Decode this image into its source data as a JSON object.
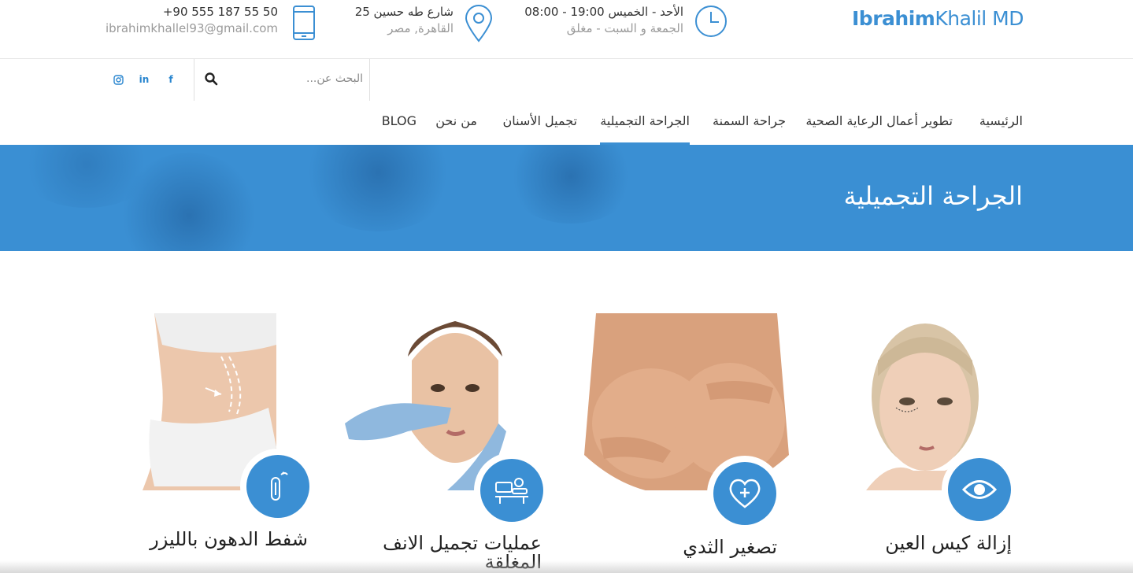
{
  "header": {
    "logo_bold": "Ibrahim",
    "logo_rest": "Khalil MD",
    "hours_line1": "الأحد - الخميس 19:00 - 08:00",
    "hours_line2": "الجمعة و السبت - مغلق",
    "address_line1": "شارع طه حسين 25",
    "address_line2": "القاهرة, مصر",
    "phone_line1": "+90 555 187 55 50",
    "phone_line2": "ibrahimkhallel93@gmail.com"
  },
  "search": {
    "placeholder": "البحث عن..."
  },
  "social": [
    "instagram-icon",
    "linkedin-icon",
    "facebook-icon"
  ],
  "social_labels": {
    "linkedin": "in",
    "facebook": "f"
  },
  "nav": {
    "items": [
      "الرئيسية",
      "تطوير أعمال الرعاية الصحية",
      "جراحة السمنة",
      "الجراحة التجميلية",
      "تجميل الأسنان",
      "من نحن",
      "BLOG"
    ],
    "active_index": 3
  },
  "banner": {
    "title": "الجراحة التجميلية"
  },
  "services": [
    {
      "title": "إزالة كيس العين",
      "icon": "eye-icon"
    },
    {
      "title": "تصغير الثدي",
      "icon": "heart-plus-icon"
    },
    {
      "title_line1": "عمليات تجميل الانف",
      "title_line2": "المغلقة",
      "icon": "surgery-table-icon"
    },
    {
      "title": "شفط الدهون بالليزر",
      "icon": "laser-thermometer-icon"
    }
  ],
  "colors": {
    "accent": "#3b8fd3",
    "banner": "#3a8fd3"
  }
}
